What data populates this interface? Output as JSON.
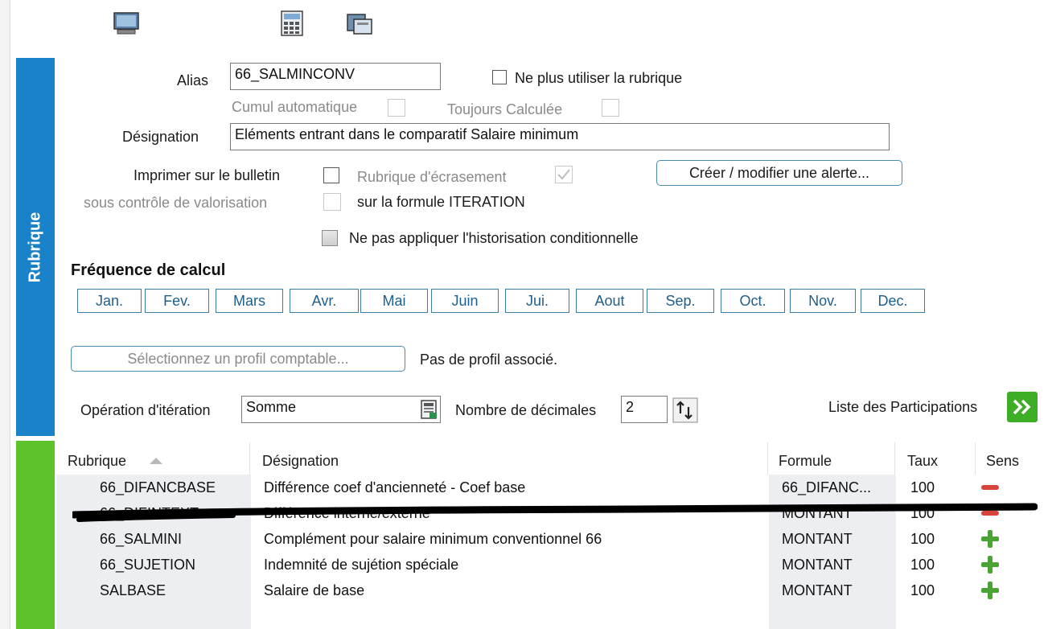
{
  "sidebar": {
    "label": "Rubrique"
  },
  "form": {
    "alias_label": "Alias",
    "alias_value": "66_SALMINCONV",
    "ne_plus_utiliser_label": "Ne plus utiliser la rubrique",
    "cumul_label": "Cumul automatique",
    "toujours_calculee_label": "Toujours Calculée",
    "designation_label": "Désignation",
    "designation_value": "Eléments entrant dans le comparatif Salaire minimum",
    "imprimer_label": "Imprimer sur le bulletin",
    "sous_controle_label": "sous contrôle de valorisation",
    "rubrique_ecrasement_label": "Rubrique d'écrasement",
    "formule_iteration_label": "sur la formule ITERATION",
    "alerte_button": "Créer / modifier une alerte...",
    "historisation_label": "Ne pas appliquer l'historisation conditionnelle"
  },
  "frequence": {
    "title": "Fréquence de calcul",
    "months": [
      "Jan.",
      "Fev.",
      "Mars",
      "Avr.",
      "Mai",
      "Juin",
      "Jui.",
      "Aout",
      "Sep.",
      "Oct.",
      "Nov.",
      "Dec."
    ]
  },
  "profil": {
    "button": "Sélectionnez un profil comptable...",
    "status": "Pas de profil associé."
  },
  "iteration": {
    "operation_label": "Opération d'itération",
    "operation_value": "Somme",
    "decimales_label": "Nombre de décimales",
    "decimales_value": "2",
    "participations_label": "Liste des Participations"
  },
  "table": {
    "columns": [
      "Rubrique",
      "Désignation",
      "Formule",
      "Taux",
      "Sens"
    ],
    "rows": [
      {
        "rubrique": "66_DIFANCBASE",
        "designation": "Différence coef d'ancienneté - Coef base",
        "formule": "66_DIFANC...",
        "taux": "100",
        "sens": "minus"
      },
      {
        "rubrique": "66_DIFINTEXT",
        "designation": "Différence interne/externe",
        "formule": "MONTANT",
        "taux": "100",
        "sens": "minus"
      },
      {
        "rubrique": "66_SALMINI",
        "designation": "Complément pour salaire minimum conventionnel 66",
        "formule": "MONTANT",
        "taux": "100",
        "sens": "plus"
      },
      {
        "rubrique": "66_SUJETION",
        "designation": "Indemnité de sujétion spéciale",
        "formule": "MONTANT",
        "taux": "100",
        "sens": "plus"
      },
      {
        "rubrique": "SALBASE",
        "designation": "Salaire de base",
        "formule": "MONTANT",
        "taux": "100",
        "sens": "plus"
      }
    ]
  },
  "colors": {
    "sidebar_blue": "#1a82c8",
    "sidebar_green": "#5cc32a",
    "accent_border": "#3a7ea6"
  }
}
